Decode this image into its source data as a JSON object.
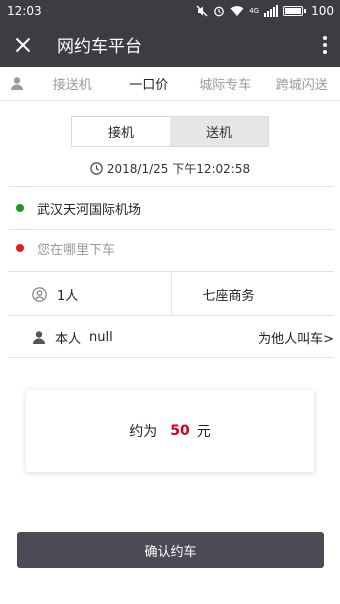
{
  "status_bar": {
    "time": "12:03",
    "network": "4G",
    "battery": "100"
  },
  "header": {
    "title": "网约车平台",
    "close_icon": "close-icon",
    "more_icon": "more-vertical-icon"
  },
  "tabs": [
    {
      "label": "接送机",
      "active": false
    },
    {
      "label": "一口价",
      "active": true
    },
    {
      "label": "城际专车",
      "active": false
    },
    {
      "label": "跨城闪送",
      "active": false
    }
  ],
  "mode_toggle": {
    "pickup": "接机",
    "dropoff": "送机",
    "selected": "接机"
  },
  "datetime": "2018/1/25 下午12:02:58",
  "origin": {
    "text": "武汉天河国际机场",
    "dot_color": "#1a9a1a"
  },
  "destination": {
    "placeholder": "您在哪里下车",
    "dot_color": "#e02020"
  },
  "passengers": "1人",
  "vehicle": "七座商务",
  "rider": {
    "label": "本人",
    "name": "null",
    "other_link": "为他人叫车>"
  },
  "price": {
    "prefix": "约为",
    "amount": "50",
    "unit": "元",
    "color": "#d0021b"
  },
  "confirm_label": "确认约车"
}
